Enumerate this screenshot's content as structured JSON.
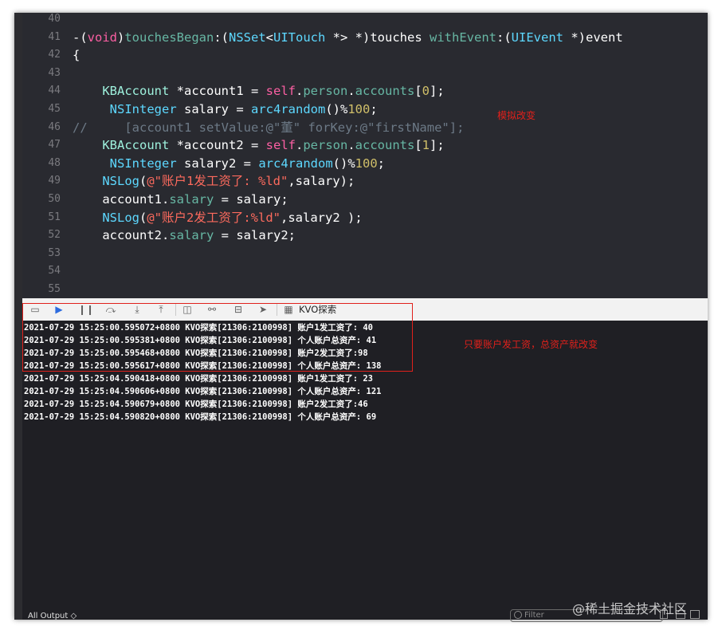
{
  "editor": {
    "lines": [
      {
        "n": "40",
        "segs": []
      },
      {
        "n": "41",
        "segs": [
          {
            "t": "-(",
            "c": ""
          },
          {
            "t": "void",
            "c": "kw"
          },
          {
            "t": ")",
            "c": ""
          },
          {
            "t": "touchesBegan",
            "c": "mth"
          },
          {
            "t": ":(",
            "c": ""
          },
          {
            "t": "NSSet",
            "c": "ty"
          },
          {
            "t": "<",
            "c": ""
          },
          {
            "t": "UITouch",
            "c": "ty"
          },
          {
            "t": " *> *)touches ",
            "c": ""
          },
          {
            "t": "withEvent",
            "c": "mth"
          },
          {
            "t": ":(",
            "c": ""
          },
          {
            "t": "UIEvent",
            "c": "ty"
          },
          {
            "t": " *)event",
            "c": ""
          }
        ]
      },
      {
        "n": "42",
        "segs": [
          {
            "t": "{",
            "c": ""
          }
        ]
      },
      {
        "n": "43",
        "segs": []
      },
      {
        "n": "44",
        "segs": [
          {
            "t": "    ",
            "c": ""
          },
          {
            "t": "KBAccount",
            "c": "cls"
          },
          {
            "t": " *account1 = ",
            "c": ""
          },
          {
            "t": "self",
            "c": "kw"
          },
          {
            "t": ".",
            "c": ""
          },
          {
            "t": "person",
            "c": "mth"
          },
          {
            "t": ".",
            "c": ""
          },
          {
            "t": "accounts",
            "c": "mth"
          },
          {
            "t": "[",
            "c": ""
          },
          {
            "t": "0",
            "c": "num"
          },
          {
            "t": "];",
            "c": ""
          }
        ]
      },
      {
        "n": "45",
        "segs": [
          {
            "t": "     ",
            "c": ""
          },
          {
            "t": "NSInteger",
            "c": "ty"
          },
          {
            "t": " salary = ",
            "c": ""
          },
          {
            "t": "arc4random",
            "c": "ty"
          },
          {
            "t": "()%",
            "c": ""
          },
          {
            "t": "100",
            "c": "num"
          },
          {
            "t": ";",
            "c": ""
          }
        ]
      },
      {
        "n": "46",
        "segs": [
          {
            "t": "//     [account1 setValue:@\"董\" forKey:@\"firstName\"];",
            "c": "cmt"
          }
        ]
      },
      {
        "n": "47",
        "segs": [
          {
            "t": "    ",
            "c": ""
          },
          {
            "t": "KBAccount",
            "c": "cls"
          },
          {
            "t": " *account2 = ",
            "c": ""
          },
          {
            "t": "self",
            "c": "kw"
          },
          {
            "t": ".",
            "c": ""
          },
          {
            "t": "person",
            "c": "mth"
          },
          {
            "t": ".",
            "c": ""
          },
          {
            "t": "accounts",
            "c": "mth"
          },
          {
            "t": "[",
            "c": ""
          },
          {
            "t": "1",
            "c": "num"
          },
          {
            "t": "];",
            "c": ""
          }
        ]
      },
      {
        "n": "48",
        "segs": [
          {
            "t": "     ",
            "c": ""
          },
          {
            "t": "NSInteger",
            "c": "ty"
          },
          {
            "t": " salary2 = ",
            "c": ""
          },
          {
            "t": "arc4random",
            "c": "ty"
          },
          {
            "t": "()%",
            "c": ""
          },
          {
            "t": "100",
            "c": "num"
          },
          {
            "t": ";",
            "c": ""
          }
        ]
      },
      {
        "n": "49",
        "segs": [
          {
            "t": "    ",
            "c": ""
          },
          {
            "t": "NSLog",
            "c": "ty"
          },
          {
            "t": "(",
            "c": ""
          },
          {
            "t": "@\"账户1发工资了: %ld\"",
            "c": "str"
          },
          {
            "t": ",salary);",
            "c": ""
          }
        ]
      },
      {
        "n": "50",
        "segs": [
          {
            "t": "    account1.",
            "c": ""
          },
          {
            "t": "salary",
            "c": "mth"
          },
          {
            "t": " = salary;",
            "c": ""
          }
        ]
      },
      {
        "n": "51",
        "segs": [
          {
            "t": "    ",
            "c": ""
          },
          {
            "t": "NSLog",
            "c": "ty"
          },
          {
            "t": "(",
            "c": ""
          },
          {
            "t": "@\"账户2发工资了:%ld\"",
            "c": "str"
          },
          {
            "t": ",salary2 );",
            "c": ""
          }
        ]
      },
      {
        "n": "52",
        "segs": [
          {
            "t": "    account2.",
            "c": ""
          },
          {
            "t": "salary",
            "c": "mth"
          },
          {
            "t": " = salary2;",
            "c": ""
          }
        ]
      },
      {
        "n": "53",
        "segs": []
      },
      {
        "n": "54",
        "segs": []
      },
      {
        "n": "55",
        "segs": []
      }
    ],
    "annotation": "模拟改变"
  },
  "toolbar": {
    "process_label": "KVO探索",
    "icons": [
      "hide-panel-icon",
      "breakpoints-icon",
      "pause-icon",
      "step-over-icon",
      "step-into-icon",
      "step-out-icon",
      "view-hierarchy-icon",
      "memory-graph-icon",
      "environment-icon",
      "location-icon"
    ]
  },
  "console": {
    "annotation": "只要账户发工资，总资产就改变",
    "lines": [
      "2021-07-29 15:25:00.595072+0800 KVO探索[21306:2100998] 账户1发工资了: 40",
      "2021-07-29 15:25:00.595381+0800 KVO探索[21306:2100998] 个人账户总资产: 41",
      "2021-07-29 15:25:00.595468+0800 KVO探索[21306:2100998] 账户2发工资了:98",
      "2021-07-29 15:25:00.595617+0800 KVO探索[21306:2100998] 个人账户总资产: 138",
      "2021-07-29 15:25:04.590418+0800 KVO探索[21306:2100998] 账户1发工资了: 23",
      "2021-07-29 15:25:04.590606+0800 KVO探索[21306:2100998] 个人账户总资产: 121",
      "2021-07-29 15:25:04.590679+0800 KVO探索[21306:2100998] 账户2发工资了:46",
      "2021-07-29 15:25:04.590820+0800 KVO探索[21306:2100998] 个人账户总资产: 69"
    ]
  },
  "bottom": {
    "scope_label": "All Output ◇",
    "filter_placeholder": "Filter"
  },
  "watermark": "@稀土掘金技术社区"
}
